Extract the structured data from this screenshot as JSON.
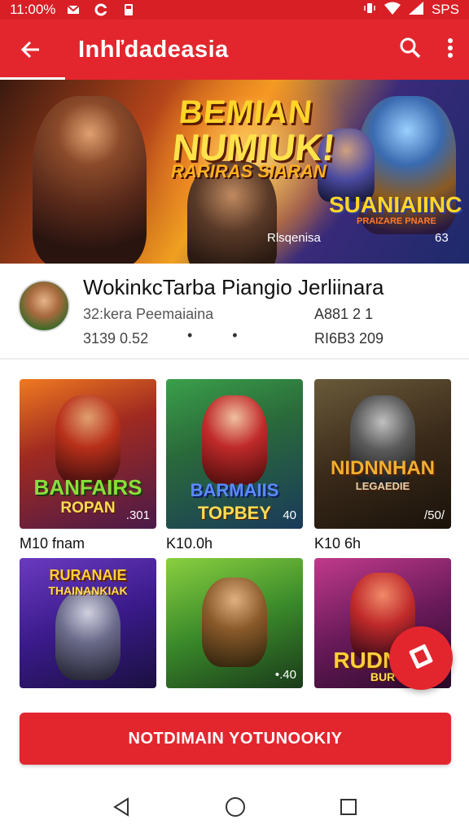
{
  "status_bar": {
    "time": "11:00%",
    "carrier": "SPS",
    "icons": [
      "gmail-icon",
      "sync-icon",
      "sd-card-icon",
      "vibrate-icon",
      "wifi-icon",
      "signal-icon"
    ]
  },
  "app_bar": {
    "title": "Inhľdadeasia",
    "icons": {
      "back": "arrow-back-icon",
      "search": "search-icon",
      "more": "more-vert-icon"
    }
  },
  "banner": {
    "headline_line1": "BEMIAN",
    "headline_line2": "NUMIUK!",
    "headline_line3": "RARIRAS SIARAN",
    "promo_title": "SUANIAIINC",
    "promo_subtitle": "PRAIZARE PNARE",
    "caption": "Rlsqenisa",
    "number": "63"
  },
  "app_info": {
    "name": "WokinkcTarba Piangio Jerliinara",
    "developer": "32:kera Peemaiaina",
    "sub": "3139 0.52",
    "dots": "• •",
    "meta1": "A881 2 1",
    "meta2": "RI6B3 209"
  },
  "tiles": [
    {
      "title": "BANFAIRS",
      "subtitle": "ROPAN",
      "num": ".301",
      "label": "M10 fnam"
    },
    {
      "title": "BARMAIIS",
      "subtitle": "TOPBEY",
      "num": "40",
      "label": "K10.0h"
    },
    {
      "title": "NIDNNHAN",
      "subtitle": "LEGAEDIE",
      "num": "/50/",
      "label": "K10 6h"
    },
    {
      "title": "RURANAIE",
      "subtitle": "THAINANKIAK",
      "num": "",
      "label": ""
    },
    {
      "title": "",
      "subtitle": "",
      "num": "•.40",
      "label": ""
    },
    {
      "title": "RUDNAN",
      "subtitle": "BUR",
      "num": "",
      "label": ""
    }
  ],
  "fab": {
    "icon": "store-tag-icon"
  },
  "cta": {
    "label": "NOTDIMAIN YOTUNOOKIY"
  },
  "nav": {
    "back": "nav-back-icon",
    "home": "nav-home-icon",
    "recents": "nav-recents-icon"
  },
  "colors": {
    "primary": "#e3262e",
    "status_bar": "#d81f26",
    "text": "#111111"
  }
}
